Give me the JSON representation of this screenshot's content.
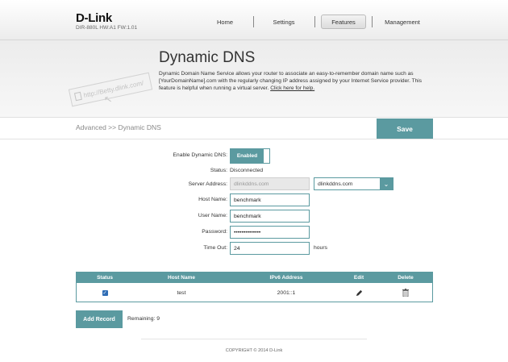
{
  "header": {
    "brand": "D-Link",
    "model": "DIR-880L   HW:A1   FW:1.01",
    "nav": [
      "Home",
      "Settings",
      "Features",
      "Management"
    ]
  },
  "banner": {
    "art_url": "http://Betty.dlink.com/",
    "title": "Dynamic DNS",
    "description": "Dynamic Domain Name Service allows your router to associate an easy-to-remember domain name such as [YourDomainName].com with the regularly changing IP address assigned by your Internet Service provider. This feature is helpful when running a virtual server. ",
    "help_link": "Click here for help."
  },
  "breadcrumb": "Advanced >> Dynamic DNS",
  "save_label": "Save",
  "form": {
    "enable_label": "Enable Dynamic DNS:",
    "enable_value": "Enabled",
    "status_label": "Status:",
    "status_value": "Disconnected",
    "server_label": "Server Address:",
    "server_value": "dlinkddns.com",
    "server_select": "dlinkddns.com",
    "host_label": "Host Name:",
    "host_value": "benchmark",
    "user_label": "User Name:",
    "user_value": "benchmark",
    "password_label": "Password:",
    "password_value": "••••••••••••••",
    "timeout_label": "Time Out:",
    "timeout_value": "24",
    "timeout_unit": "hours"
  },
  "table": {
    "columns": [
      "Status",
      "Host Name",
      "IPv6 Address",
      "Edit",
      "Delete"
    ],
    "rows": [
      {
        "status_checked": true,
        "host": "test",
        "ipv6": "2001::1"
      }
    ]
  },
  "add_record_label": "Add Record",
  "remaining": "Remaining: 9",
  "copyright": "COPYRIGHT © 2014 D-Link",
  "colors": {
    "accent": "#5b9aa0",
    "checkbox": "#2f6db5"
  },
  "icons": {
    "edit": "pencil-icon",
    "delete": "trash-icon",
    "dropdown": "chevron-down-icon",
    "checkbox": "checkbox-icon"
  }
}
